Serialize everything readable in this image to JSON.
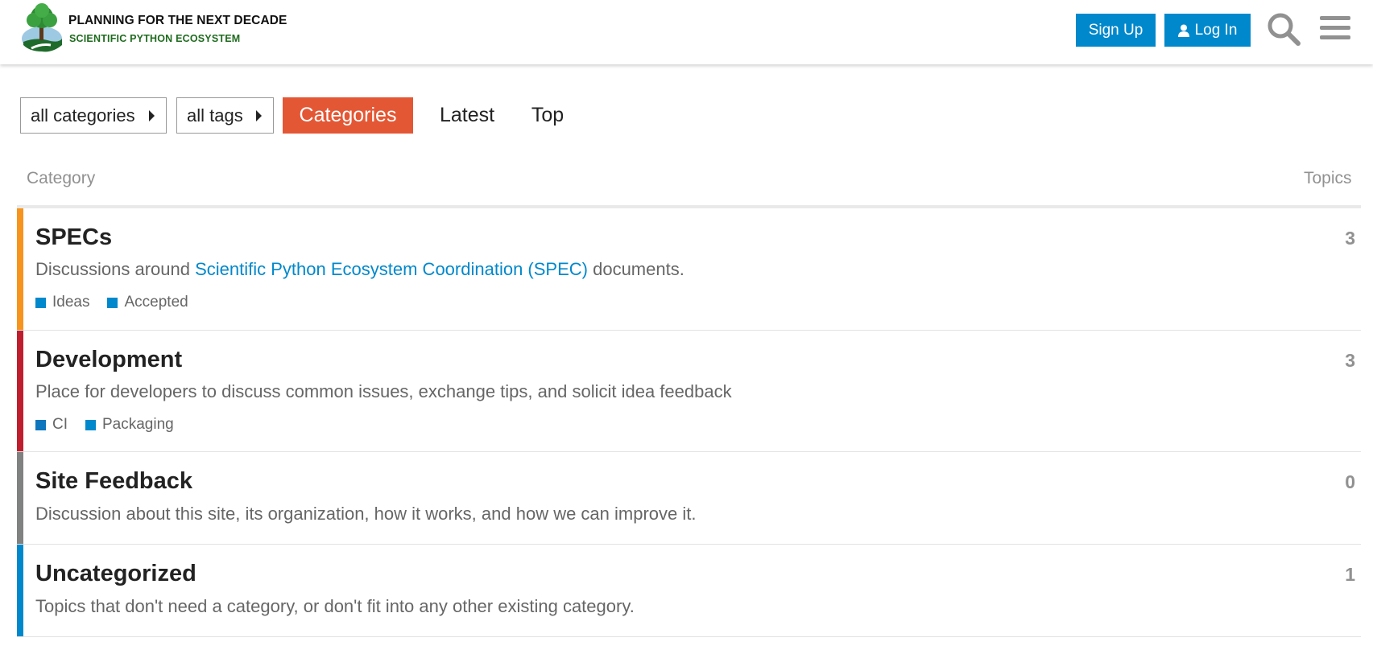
{
  "header": {
    "logo_title": "PLANNING FOR THE NEXT DECADE",
    "logo_subtitle": "SCIENTIFIC PYTHON ECOSYSTEM",
    "signup_label": "Sign Up",
    "login_label": "Log In"
  },
  "nav": {
    "categories_dropdown": "all categories",
    "tags_dropdown": "all tags",
    "tabs": [
      {
        "label": "Categories",
        "active": true
      },
      {
        "label": "Latest",
        "active": false
      },
      {
        "label": "Top",
        "active": false
      }
    ]
  },
  "table": {
    "col_category": "Category",
    "col_topics": "Topics",
    "rows": [
      {
        "name": "SPECs",
        "color": "#f7941d",
        "desc_before": "Discussions around ",
        "desc_link": "Scientific Python Ecosystem Coordination (SPEC)",
        "desc_after": " documents.",
        "topics": "3",
        "subcategories": [
          {
            "label": "Ideas",
            "color": "#0088cc"
          },
          {
            "label": "Accepted",
            "color": "#0088cc"
          }
        ]
      },
      {
        "name": "Development",
        "color": "#bf1e2e",
        "desc": "Place for developers to discuss common issues, exchange tips, and solicit idea feedback",
        "topics": "3",
        "subcategories": [
          {
            "label": "CI",
            "color": "#0e76bd"
          },
          {
            "label": "Packaging",
            "color": "#0088cc"
          }
        ]
      },
      {
        "name": "Site Feedback",
        "color": "#808281",
        "desc": "Discussion about this site, its organization, how it works, and how we can improve it.",
        "topics": "0"
      },
      {
        "name": "Uncategorized",
        "color": "#0088cc",
        "desc": "Topics that don't need a category, or don't fit into any other existing category.",
        "topics": "1"
      }
    ]
  },
  "colors": {
    "accent": "#0088cc",
    "active_tab": "#e45735"
  }
}
